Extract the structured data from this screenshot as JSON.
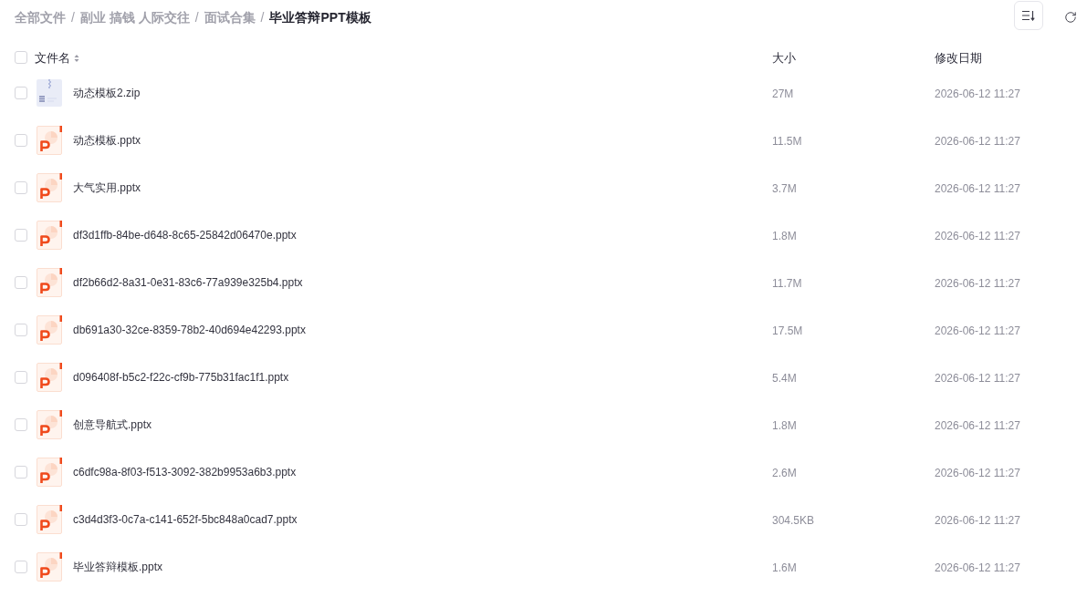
{
  "breadcrumb": [
    {
      "label": "全部文件",
      "current": false,
      "separator": "/"
    },
    {
      "label": "副业 搞钱 人际交往",
      "current": false,
      "separator": "/"
    },
    {
      "label": "面试合集",
      "current": false,
      "separator": "/"
    },
    {
      "label": "毕业答辩PPT模板",
      "current": true
    }
  ],
  "table": {
    "select_all": {
      "checked": false
    },
    "columns": [
      {
        "label": "文件名",
        "sortable": true
      },
      {
        "label": "大小",
        "sortable": false
      },
      {
        "label": "修改日期",
        "sortable": false
      }
    ],
    "rows": [
      {
        "kind": "zip",
        "name": "动态模板2.zip",
        "size": "27M",
        "modified": "2026-06-12 11:27",
        "checked": false
      },
      {
        "kind": "pptx",
        "name": "动态模板.pptx",
        "size": "11.5M",
        "modified": "2026-06-12 11:27",
        "checked": false
      },
      {
        "kind": "pptx",
        "name": "大气实用.pptx",
        "size": "3.7M",
        "modified": "2026-06-12 11:27",
        "checked": false
      },
      {
        "kind": "pptx",
        "name": "df3d1ffb-84be-d648-8c65-25842d06470e.pptx",
        "size": "1.8M",
        "modified": "2026-06-12 11:27",
        "checked": false
      },
      {
        "kind": "pptx",
        "name": "df2b66d2-8a31-0e31-83c6-77a939e325b4.pptx",
        "size": "11.7M",
        "modified": "2026-06-12 11:27",
        "checked": false
      },
      {
        "kind": "pptx",
        "name": "db691a30-32ce-8359-78b2-40d694e42293.pptx",
        "size": "17.5M",
        "modified": "2026-06-12 11:27",
        "checked": false
      },
      {
        "kind": "pptx",
        "name": "d096408f-b5c2-f22c-cf9b-775b31fac1f1.pptx",
        "size": "5.4M",
        "modified": "2026-06-12 11:27",
        "checked": false
      },
      {
        "kind": "pptx",
        "name": "创意导航式.pptx",
        "size": "1.8M",
        "modified": "2026-06-12 11:27",
        "checked": false
      },
      {
        "kind": "pptx",
        "name": "c6dfc98a-8f03-f513-3092-382b9953a6b3.pptx",
        "size": "2.6M",
        "modified": "2026-06-12 11:27",
        "checked": false
      },
      {
        "kind": "pptx",
        "name": "c3d4d3f3-0c7a-c141-652f-5bc848a0cad7.pptx",
        "size": "304.5KB",
        "modified": "2026-06-12 11:27",
        "checked": false
      },
      {
        "kind": "pptx",
        "name": "毕业答辩模板.pptx",
        "size": "1.6M",
        "modified": "2026-06-12 11:27",
        "checked": false
      }
    ]
  }
}
